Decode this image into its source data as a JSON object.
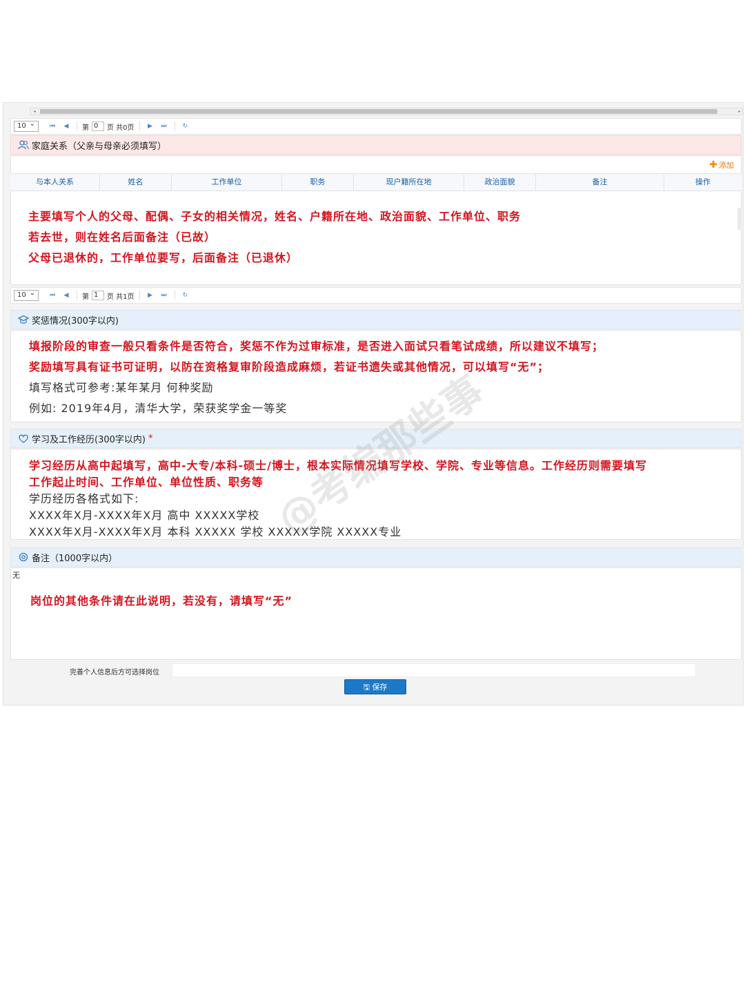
{
  "pager_top": {
    "page_size": "10",
    "page_prefix": "第",
    "page_num": "0",
    "page_suffix": "页 共0页"
  },
  "family": {
    "title": "家庭关系（父亲与母亲必须填写）",
    "add_label": "添加",
    "columns": [
      "与本人关系",
      "姓名",
      "工作单位",
      "职务",
      "现户籍所在地",
      "政治面貌",
      "备注",
      "操作"
    ],
    "notes": [
      "主要填写个人的父母、配偶、子女的相关情况，姓名、户籍所在地、政治面貌、工作单位、职务",
      "若去世，则在姓名后面备注（已故）",
      "父母已退休的，工作单位要写，后面备注（已退休）"
    ]
  },
  "pager_bottom": {
    "page_size": "10",
    "page_prefix": "第",
    "page_num": "1",
    "page_suffix": "页 共1页"
  },
  "awards": {
    "title": "奖惩情况(300字以内)",
    "lines_red": [
      "填报阶段的审查一般只看条件是否符合，奖惩不作为过审标准，是否进入面试只看笔试成绩，所以建议不填写；",
      "奖励填写具有证书可证明，以防在资格复审阶段造成麻烦，若证书遗失或其他情况，可以填写“无”；"
    ],
    "lines_dark": [
      "填写格式可参考:某年某月 何种奖励",
      "例如: 2019年4月，清华大学，荣获奖学金一等奖"
    ]
  },
  "experience": {
    "title": "学习及工作经历(300字以内)",
    "required_mark": "*",
    "lines_red": [
      "学习经历从高中起填写，高中-大专/本科-硕士/博士，根本实际情况填写学校、学院、专业等信息。工作经历则需要填写",
      "工作起止时间、工作单位、单位性质、职务等"
    ],
    "lines_dark": [
      "学历经历各格式如下:",
      "XXXX年X月-XXXX年X月  高中  XXXXX学校",
      "XXXX年X月-XXXX年X月  本科  XXXXX  学校  XXXXX学院  XXXXX专业"
    ]
  },
  "remarks": {
    "title": "备注（1000字以内）",
    "value": "无",
    "note": "岗位的其他条件请在此说明，若没有，请填写“无”"
  },
  "footer": {
    "hint": "完善个人信息后方可选择岗位",
    "save_label": "保存"
  },
  "watermark": "@考编那些事",
  "colors": {
    "accent_red": "#d4141d",
    "link_blue": "#1a5fa8",
    "save_blue": "#1d79c7",
    "family_head_bg": "#fde8e8",
    "section_head_bg": "#e6f0fa"
  }
}
